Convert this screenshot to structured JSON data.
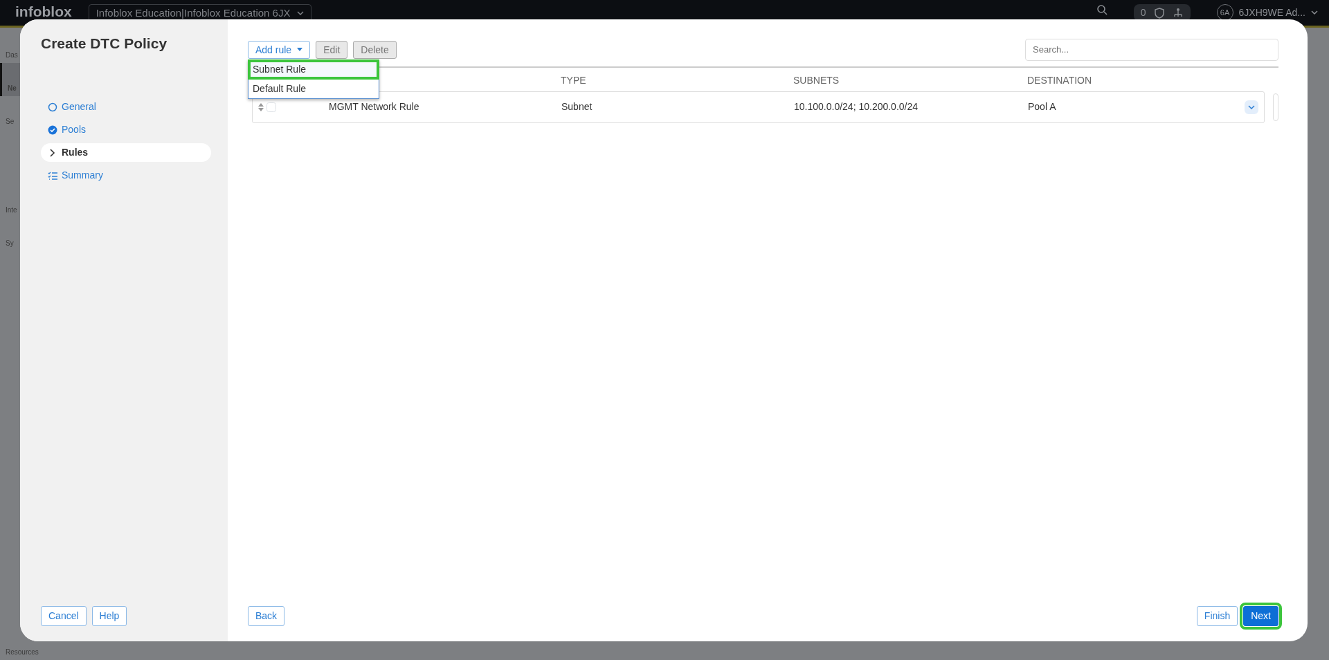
{
  "app_bar": {
    "logo": "infoblox",
    "workspace": "Infoblox Education|Infoblox Education 6JX",
    "counter": "0",
    "avatar": "6A",
    "user": "6JXH9WE Ad..."
  },
  "app_nav": [
    {
      "label": "Das",
      "selected": false
    },
    {
      "label": "Ne",
      "selected": true
    },
    {
      "label": "Se",
      "selected": false
    },
    {
      "label": "Inte",
      "selected": false
    },
    {
      "label": "Sy",
      "selected": false
    },
    {
      "label": "Resources",
      "selected": false
    }
  ],
  "dialog": {
    "title": "Create DTC Policy",
    "steps": [
      {
        "label": "General",
        "kind": "todo",
        "selected": false
      },
      {
        "label": "Pools",
        "kind": "done",
        "selected": false
      },
      {
        "label": "Rules",
        "kind": "current",
        "selected": true
      },
      {
        "label": "Summary",
        "kind": "summary",
        "selected": false
      }
    ],
    "toolbar": {
      "add_button": "Add rule",
      "edit_button": "Edit",
      "delete_button": "Delete",
      "search": {
        "placeholder": "Search..."
      }
    },
    "add_menu": [
      {
        "label": "Subnet Rule",
        "highlighted": true
      },
      {
        "label": "Default Rule",
        "highlighted": false
      }
    ],
    "table": {
      "columns": [
        "TYPE",
        "SUBNETS",
        "DESTINATION"
      ],
      "rows": [
        {
          "name": "MGMT Network Rule",
          "type": "Subnet",
          "subnets": "10.100.0.0/24; 10.200.0.0/24",
          "destination": "Pool A",
          "checked": false
        }
      ]
    },
    "left_buttons": [
      "Cancel",
      "Help"
    ],
    "back_button": "Back",
    "right_buttons": [
      {
        "label": "Finish",
        "primary": false,
        "highlighted": false
      },
      {
        "label": "Next",
        "primary": true,
        "highlighted": true
      }
    ]
  }
}
